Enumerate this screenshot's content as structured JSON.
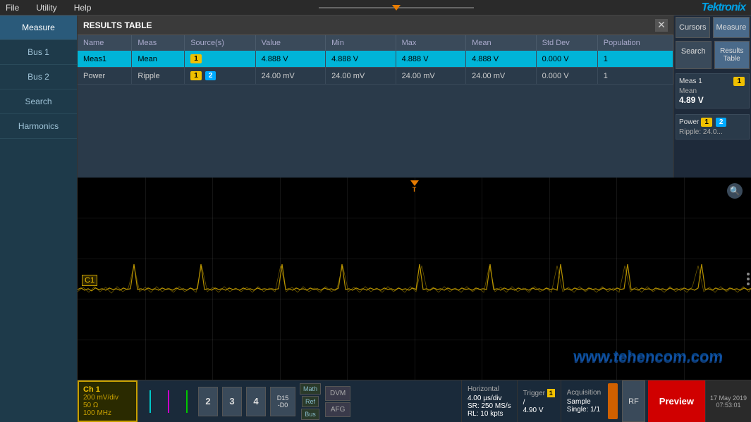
{
  "menubar": {
    "file": "File",
    "utility": "Utility",
    "help": "Help",
    "logo": "Tektronix"
  },
  "sidebar": {
    "items": [
      {
        "id": "measure",
        "label": "Measure"
      },
      {
        "id": "bus1",
        "label": "Bus 1"
      },
      {
        "id": "bus2",
        "label": "Bus 2"
      },
      {
        "id": "search",
        "label": "Search"
      },
      {
        "id": "harmonics",
        "label": "Harmonics"
      }
    ]
  },
  "results_table": {
    "title": "RESULTS TABLE",
    "close": "✕",
    "columns": [
      "Name",
      "Meas",
      "Source(s)",
      "Value",
      "Min",
      "Max",
      "Mean",
      "Std Dev",
      "Population"
    ],
    "rows": [
      {
        "name": "Meas1",
        "meas": "Mean",
        "source": "1",
        "value": "4.888 V",
        "min": "4.888 V",
        "max": "4.888 V",
        "mean": "4.888 V",
        "std_dev": "0.000 V",
        "population": "1",
        "highlight": true
      },
      {
        "name": "Power",
        "meas": "Ripple",
        "source": "1,2",
        "value": "24.00 mV",
        "min": "24.00 mV",
        "max": "24.00 mV",
        "mean": "24.00 mV",
        "std_dev": "0.000 V",
        "population": "1",
        "highlight": false
      }
    ]
  },
  "right_panel": {
    "cursors": "Cursors",
    "measure": "Measure",
    "search": "Search",
    "results_table": "Results\nTable",
    "meas1": {
      "label": "Meas 1",
      "badge": "1",
      "type": "Mean",
      "value": "4.89 V"
    },
    "power": {
      "label": "Power",
      "badge1": "1",
      "badge2": "2",
      "type": "Ripple:",
      "value": "24.0..."
    }
  },
  "waveform": {
    "trigger_label": "T",
    "c1_label": "C1",
    "ch1": {
      "label": "Ch 1",
      "scale": "200 mV/div",
      "impedance": "50 Ω",
      "bandwidth": "100 MHz"
    }
  },
  "bottom_bar": {
    "ch1": {
      "label": "Ch 1",
      "scale": "200 mV/div",
      "impedance": "50 Ω",
      "bandwidth": "100 MHz"
    },
    "num2": "2",
    "num3": "3",
    "num4": "4",
    "d15": "D15",
    "d0": "-D0",
    "math": "Math",
    "ref": "Ref",
    "bus": "Bus",
    "dvm": "DVM",
    "afg": "AFG",
    "horizontal": {
      "title": "Horizontal",
      "time_div": "4.00 µs/div",
      "sr": "SR: 250 MS/s",
      "rl": "RL: 10 kpts"
    },
    "trigger": {
      "title": "Trigger",
      "badge": "1",
      "value": "4.90 V",
      "icon": "/"
    },
    "acquisition": {
      "title": "Acquisition",
      "mode": "Sample",
      "rate": "Single: 1/1"
    },
    "rf": "RF",
    "preview": "Preview",
    "date": "17 May 2019",
    "time": "07:53:01"
  },
  "watermark": "www.tehencom.com"
}
